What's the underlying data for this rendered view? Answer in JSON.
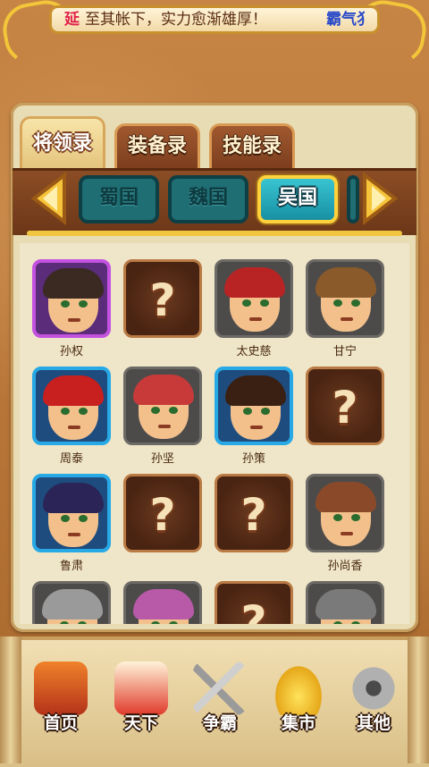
{
  "marquee": {
    "name": "延",
    "message": "至其帐下，实力愈渐雄厚！",
    "tail": "霸气犭"
  },
  "tabs": [
    {
      "label": "将领录",
      "active": true
    },
    {
      "label": "装备录",
      "active": false
    },
    {
      "label": "技能录",
      "active": false
    }
  ],
  "kingdoms": [
    {
      "label": "蜀国",
      "active": false
    },
    {
      "label": "魏国",
      "active": false
    },
    {
      "label": "吴国",
      "active": true
    }
  ],
  "generals": [
    {
      "name": "孙权",
      "status": "owned",
      "frame": "purple",
      "hair": "#3a2a22"
    },
    {
      "name": "",
      "status": "unknown"
    },
    {
      "name": "太史慈",
      "status": "seen",
      "frame": "gray",
      "hair": "#b82424"
    },
    {
      "name": "甘宁",
      "status": "seen",
      "frame": "gray",
      "hair": "#8a5a2a"
    },
    {
      "name": "周泰",
      "status": "owned",
      "frame": "blue",
      "hair": "#c81f1f"
    },
    {
      "name": "孙坚",
      "status": "seen",
      "frame": "gray",
      "hair": "#c83a3a"
    },
    {
      "name": "孙策",
      "status": "owned",
      "frame": "blue",
      "hair": "#3a2012"
    },
    {
      "name": "",
      "status": "unknown"
    },
    {
      "name": "鲁肃",
      "status": "owned",
      "frame": "blue",
      "hair": "#2b2456"
    },
    {
      "name": "",
      "status": "unknown"
    },
    {
      "name": "",
      "status": "unknown"
    },
    {
      "name": "孙尚香",
      "status": "seen",
      "frame": "gray",
      "hair": "#8a4a2a"
    },
    {
      "name": "",
      "status": "seen",
      "frame": "gray",
      "hair": "#9a9a9a"
    },
    {
      "name": "",
      "status": "seen",
      "frame": "gray",
      "hair": "#b85aa8"
    },
    {
      "name": "",
      "status": "unknown"
    },
    {
      "name": "",
      "status": "seen",
      "frame": "gray",
      "hair": "#7a7a7a"
    }
  ],
  "unknown_mark": "?",
  "nav": [
    {
      "label": "首页",
      "icon": "palace-icon",
      "color": "#c8461f"
    },
    {
      "label": "天下",
      "icon": "scroll-map-icon",
      "color": "#d83a2a"
    },
    {
      "label": "争霸",
      "icon": "crossed-swords-icon",
      "color": "#8a8a8a"
    },
    {
      "label": "集市",
      "icon": "gold-ingot-icon",
      "color": "#f2c22a"
    },
    {
      "label": "其他",
      "icon": "gear-icon",
      "color": "#9a9a9a"
    }
  ],
  "colors": {
    "accent_gold": "#f2c641",
    "wood": "#8b4d25",
    "teal": "#1f6e73"
  }
}
